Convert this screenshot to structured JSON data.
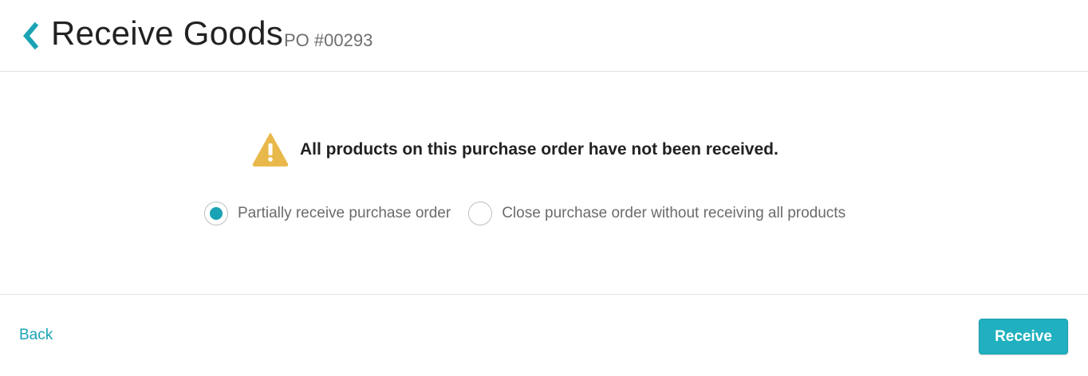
{
  "header": {
    "title": "Receive Goods",
    "po_number": "PO #00293",
    "back_icon": "chevron-left-icon"
  },
  "warning": {
    "icon": "warning-triangle-icon",
    "message": "All products on this purchase order have not been received."
  },
  "options": [
    {
      "label": "Partially receive purchase order",
      "selected": true
    },
    {
      "label": "Close purchase order without receiving all products",
      "selected": false
    }
  ],
  "footer": {
    "back_label": "Back",
    "receive_label": "Receive"
  },
  "colors": {
    "accent": "#1aa3b4",
    "warning": "#e8b94a",
    "button": "#20b0bf"
  }
}
